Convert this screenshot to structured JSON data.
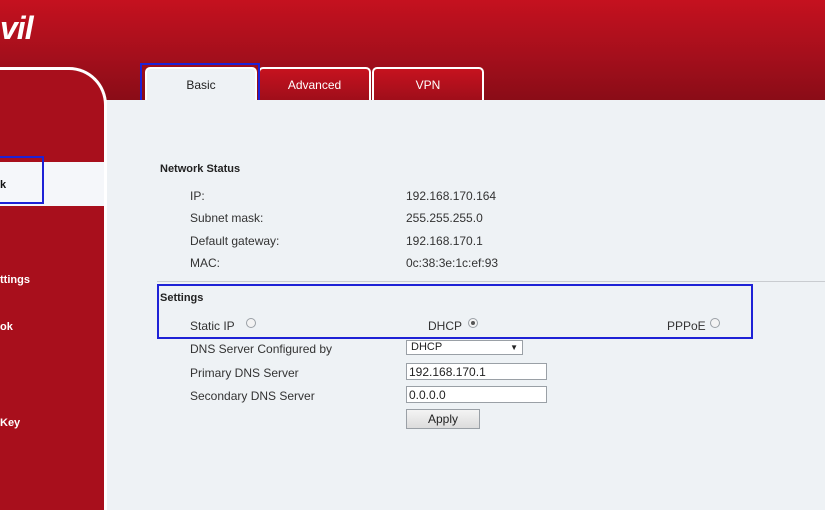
{
  "brand": {
    "logo_text": "vil"
  },
  "tabs": [
    {
      "label": "Basic",
      "active": true
    },
    {
      "label": "Advanced",
      "active": false
    },
    {
      "label": "VPN",
      "active": false
    }
  ],
  "sidebar": {
    "items": [
      {
        "label": "k",
        "active": true
      },
      {
        "label": "ttings"
      },
      {
        "label": "ok"
      },
      {
        "label": "Key"
      }
    ]
  },
  "network_status": {
    "title": "Network Status",
    "rows": [
      {
        "label": "IP:",
        "value": "192.168.170.164"
      },
      {
        "label": "Subnet mask:",
        "value": "255.255.255.0"
      },
      {
        "label": "Default gateway:",
        "value": "192.168.170.1"
      },
      {
        "label": "MAC:",
        "value": "0c:38:3e:1c:ef:93"
      }
    ]
  },
  "settings": {
    "title": "Settings",
    "modes": [
      {
        "label": "Static IP",
        "selected": false
      },
      {
        "label": "DHCP",
        "selected": true
      },
      {
        "label": "PPPoE",
        "selected": false
      }
    ],
    "dns_configured_by": {
      "label": "DNS Server Configured by",
      "value": "DHCP"
    },
    "primary_dns": {
      "label": "Primary DNS Server",
      "value": "192.168.170.1"
    },
    "secondary_dns": {
      "label": "Secondary DNS Server",
      "value": "0.0.0.0"
    },
    "apply_label": "Apply"
  },
  "colors": {
    "brand_red": "#a80f1c",
    "highlight": "#1e22d6",
    "content_bg": "#eef2f5"
  }
}
